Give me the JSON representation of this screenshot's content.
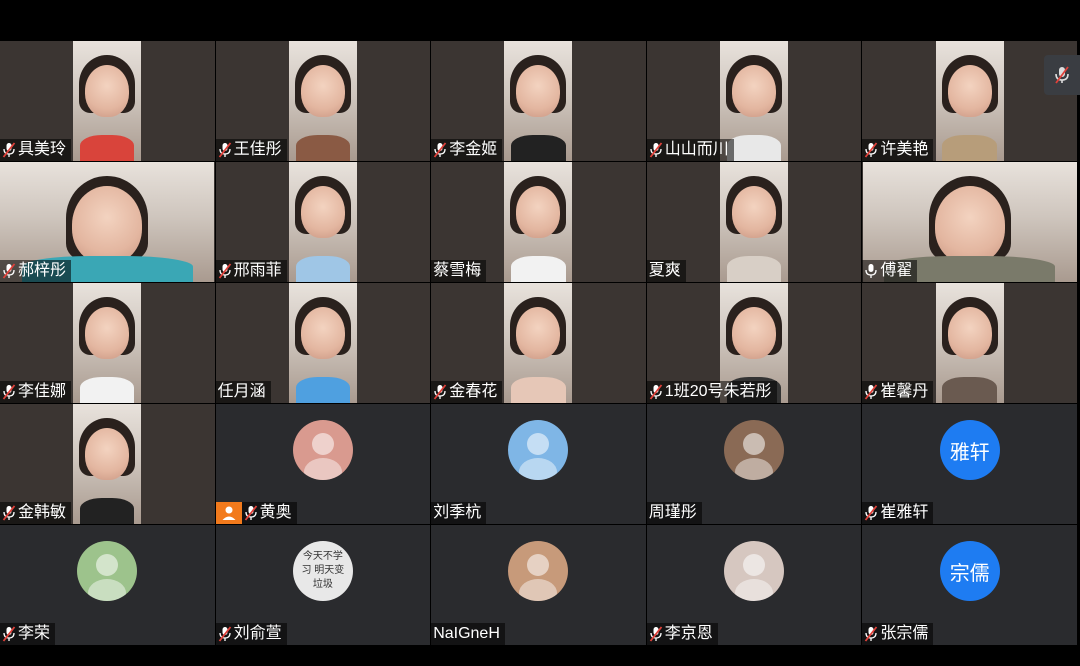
{
  "participants": [
    {
      "name": "具美玲",
      "muted": true,
      "type": "video",
      "shirt": "#d9443b"
    },
    {
      "name": "王佳彤",
      "muted": true,
      "type": "video",
      "shirt": "#8a5a44"
    },
    {
      "name": "李金姬",
      "muted": true,
      "type": "video",
      "shirt": "#222222"
    },
    {
      "name": "山山而川",
      "muted": true,
      "type": "video",
      "shirt": "#e8e8e8"
    },
    {
      "name": "许美艳",
      "muted": true,
      "type": "video",
      "shirt": "#b79d7a"
    },
    {
      "name": "郝梓彤",
      "muted": true,
      "type": "video",
      "shirt": "#3aa7b5"
    },
    {
      "name": "邢雨菲",
      "muted": true,
      "type": "video",
      "shirt": "#9fc6e6"
    },
    {
      "name": "蔡雪梅",
      "muted": false,
      "type": "video",
      "shirt": "#f2f2f2"
    },
    {
      "name": "夏爽",
      "muted": false,
      "type": "video",
      "shirt": "#d8cfc6"
    },
    {
      "name": "傅翟",
      "muted": false,
      "mic_on": true,
      "type": "video",
      "shirt": "#7a7a6a"
    },
    {
      "name": "李佳娜",
      "muted": true,
      "type": "video",
      "shirt": "#f2f2f2"
    },
    {
      "name": "任月涵",
      "muted": false,
      "type": "video",
      "shirt": "#4fa0e0"
    },
    {
      "name": "金春花",
      "muted": true,
      "type": "video",
      "shirt": "#e6c7b7"
    },
    {
      "name": "1班20号朱若彤",
      "muted": true,
      "type": "video",
      "shirt": "#333333"
    },
    {
      "name": "崔馨丹",
      "muted": true,
      "type": "video",
      "shirt": "#6a5a50"
    },
    {
      "name": "金韩敏",
      "muted": true,
      "type": "video",
      "shirt": "#222222"
    },
    {
      "name": "黄奥",
      "muted": true,
      "host": true,
      "type": "avatar",
      "avatar_color": "#d99a8f"
    },
    {
      "name": "刘季杭",
      "muted": false,
      "type": "avatar",
      "avatar_color": "#7fb6e6"
    },
    {
      "name": "周瑾彤",
      "muted": false,
      "type": "avatar",
      "avatar_color": "#8a6a55"
    },
    {
      "name": "崔雅轩",
      "muted": true,
      "type": "avatar",
      "initial": "雅轩",
      "avatar_color": "#1e7cf2"
    },
    {
      "name": "李荣",
      "muted": true,
      "type": "avatar",
      "avatar_color": "#9dc38c"
    },
    {
      "name": "刘俞萱",
      "muted": true,
      "type": "avatar",
      "avatar_text": "今天不学习 明天变垃圾",
      "avatar_color": "#e8e8e8"
    },
    {
      "name": "NaIGneH",
      "muted": false,
      "type": "avatar",
      "avatar_color": "#c79a7a"
    },
    {
      "name": "李京恩",
      "muted": true,
      "type": "avatar",
      "avatar_color": "#d6c7c0"
    },
    {
      "name": "张宗儒",
      "muted": true,
      "type": "avatar",
      "initial": "宗儒",
      "avatar_color": "#1e7cf2"
    }
  ],
  "side_button": {
    "icon": "mic-muted-icon"
  }
}
